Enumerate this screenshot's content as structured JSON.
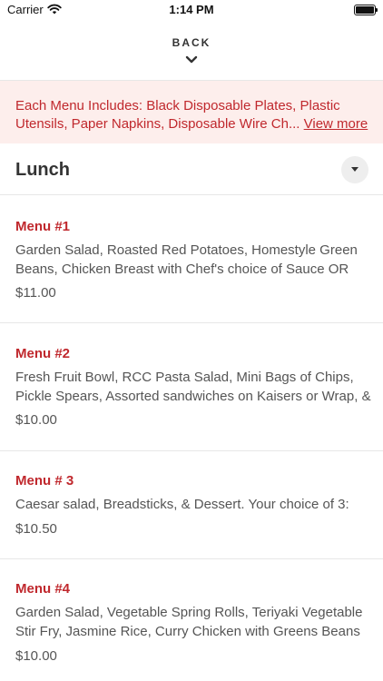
{
  "status_bar": {
    "carrier": "Carrier",
    "time": "1:14 PM"
  },
  "header": {
    "back_label": "BACK"
  },
  "banner": {
    "text": "Each Menu Includes: Black Disposable Plates, Plastic Utensils, Paper Napkins, Disposable Wire Ch...",
    "link": "View more"
  },
  "section": {
    "title": "Lunch"
  },
  "menu_items": [
    {
      "title": "Menu #1",
      "description": "Garden Salad, Roasted Red Potatoes, Homestyle Green Beans, Chicken Breast with Chef's choice of Sauce OR",
      "price": "$11.00"
    },
    {
      "title": "Menu #2",
      "description": "Fresh Fruit Bowl, RCC Pasta Salad, Mini Bags of Chips, Pickle Spears, Assorted sandwiches on Kaisers or Wrap, &",
      "price": "$10.00"
    },
    {
      "title": "Menu # 3",
      "description": "Caesar salad, Breadsticks, & Dessert. Your choice of 3:",
      "price": "$10.50"
    },
    {
      "title": "Menu #4",
      "description": "Garden Salad, Vegetable Spring Rolls, Teriyaki Vegetable Stir Fry, Jasmine Rice, Curry Chicken with Greens Beans",
      "price": "$10.00"
    }
  ],
  "colors": {
    "accent": "#c0282d",
    "banner_bg": "#fdeeec"
  },
  "icons": [
    "wifi-icon",
    "battery-icon",
    "chevron-down-icon",
    "dropdown-triangle-icon"
  ]
}
